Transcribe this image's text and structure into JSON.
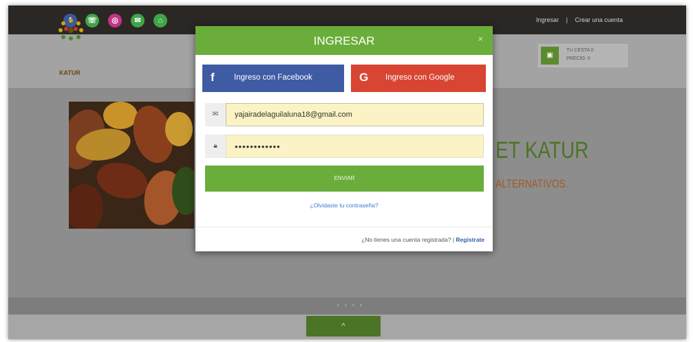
{
  "topbar": {
    "social_icons": [
      {
        "name": "facebook-icon",
        "glyph": "f",
        "color": "#3b5998"
      },
      {
        "name": "whatsapp-icon",
        "glyph": "☏",
        "color": "#3fa548"
      },
      {
        "name": "instagram-icon",
        "glyph": "◎",
        "color": "#c13584"
      },
      {
        "name": "email-icon",
        "glyph": "✉",
        "color": "#3fa548"
      },
      {
        "name": "home-icon",
        "glyph": "⌂",
        "color": "#3fa548"
      }
    ],
    "login_link": "Ingresar",
    "separator": "|",
    "signup_link": "Crear una cuenta"
  },
  "header": {
    "logo_text": "KATUR",
    "cart_line1": "TU CESTA 0",
    "cart_line2": "PRECIO: 0",
    "cart_icon": "basket-icon"
  },
  "hero": {
    "title": "ET KATUR",
    "subtitle": "ALTERNATIVOS."
  },
  "carousel": {
    "dots": "• • • •",
    "scroll_top": "^"
  },
  "modal": {
    "title": "INGRESAR",
    "close": "×",
    "facebook_label": "Ingreso con Facebook",
    "google_label": "Ingreso con Google",
    "email_value": "yajairadelaguilaluna18@gmail.com",
    "password_value": "••••••••••••",
    "submit_label": "ENVIAR",
    "forgot_link": "¿Olvidaste tu contraseña?",
    "footer_question": "¿No tienes una cuenta registrada? |",
    "register_link": "Regístrate"
  },
  "colors": {
    "accent_green": "#6aad3a",
    "facebook_blue": "#3e5ba4",
    "google_red": "#d84533"
  }
}
